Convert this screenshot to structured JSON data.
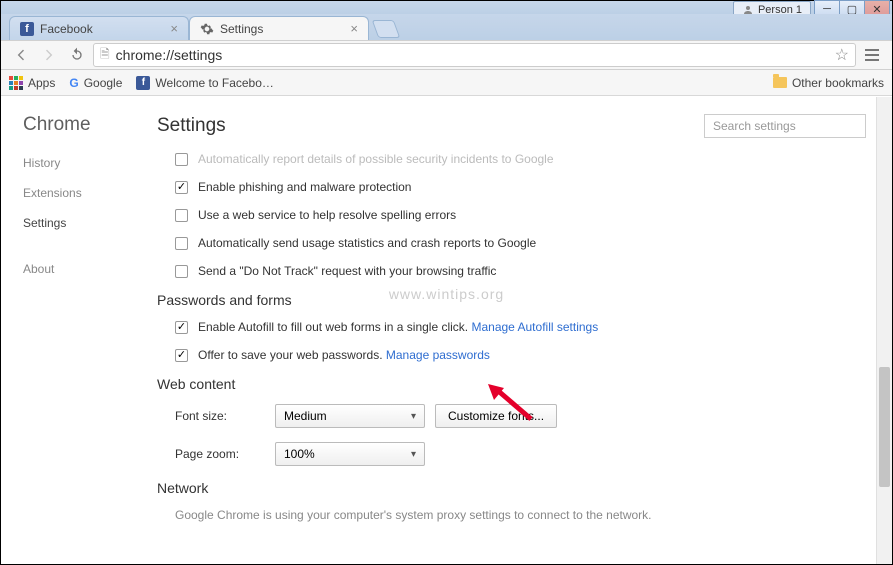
{
  "window": {
    "profile_label": "Person 1"
  },
  "tabs": {
    "t0": {
      "title": "Facebook"
    },
    "t1": {
      "title": "Settings"
    }
  },
  "toolbar": {
    "url": "chrome://settings"
  },
  "bookmarks": {
    "apps": "Apps",
    "google": "Google",
    "welcome": "Welcome to Facebo…",
    "other": "Other bookmarks"
  },
  "sidebar": {
    "brand": "Chrome",
    "history": "History",
    "extensions": "Extensions",
    "settings": "Settings",
    "about": "About"
  },
  "main": {
    "title": "Settings",
    "search_placeholder": "Search settings",
    "privacy": {
      "opt_cut": "Automatically report details of possible security incidents to Google",
      "opt_phishing": "Enable phishing and malware protection",
      "opt_spelling": "Use a web service to help resolve spelling errors",
      "opt_usage": "Automatically send usage statistics and crash reports to Google",
      "opt_dnt": "Send a \"Do Not Track\" request with your browsing traffic"
    },
    "passwords": {
      "heading": "Passwords and forms",
      "opt_autofill": "Enable Autofill to fill out web forms in a single click. ",
      "link_autofill": "Manage Autofill settings",
      "opt_save": "Offer to save your web passwords. ",
      "link_manage": "Manage passwords"
    },
    "webcontent": {
      "heading": "Web content",
      "font_label": "Font size:",
      "font_value": "Medium",
      "customize_btn": "Customize fonts...",
      "zoom_label": "Page zoom:",
      "zoom_value": "100%"
    },
    "network": {
      "heading": "Network",
      "desc": "Google Chrome is using your computer's system proxy settings to connect to the network."
    }
  },
  "watermark": "www.wintips.org"
}
